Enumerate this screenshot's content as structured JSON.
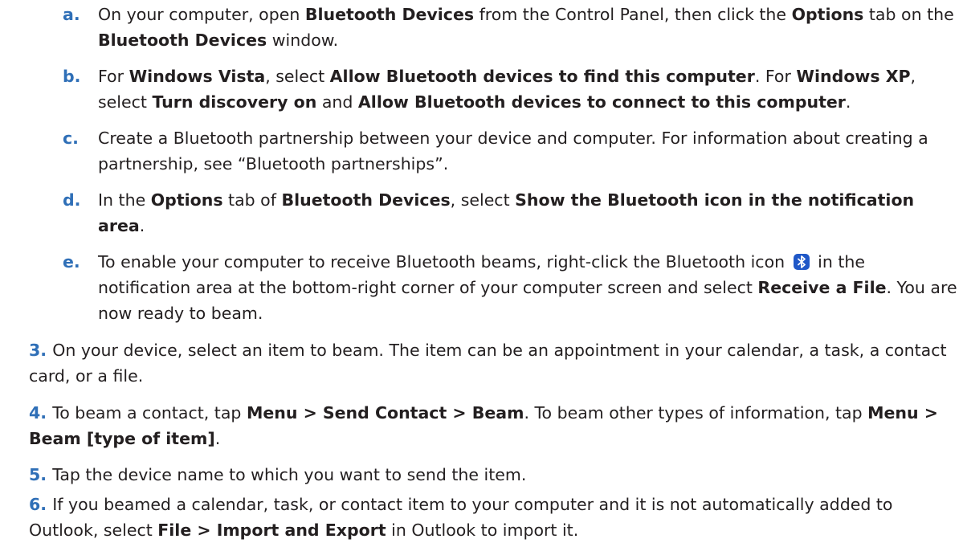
{
  "colors": {
    "marker": "#2f6fb7",
    "text": "#231f20",
    "bluetooth_icon": "#1f57c7"
  },
  "sub_steps": [
    {
      "marker": "a.",
      "segments": [
        {
          "t": "On your computer, open ",
          "b": false
        },
        {
          "t": "Bluetooth Devices",
          "b": true
        },
        {
          "t": " from the Control Panel, then click the ",
          "b": false
        },
        {
          "t": "Options",
          "b": true
        },
        {
          "t": " tab on the ",
          "b": false
        },
        {
          "t": "Bluetooth Devices",
          "b": true
        },
        {
          "t": " window.",
          "b": false
        }
      ]
    },
    {
      "marker": "b.",
      "segments": [
        {
          "t": "For ",
          "b": false
        },
        {
          "t": "Windows Vista",
          "b": true
        },
        {
          "t": ", select ",
          "b": false
        },
        {
          "t": "Allow Bluetooth devices to find this computer",
          "b": true
        },
        {
          "t": ". For ",
          "b": false
        },
        {
          "t": "Windows XP",
          "b": true
        },
        {
          "t": ", select ",
          "b": false
        },
        {
          "t": "Turn discovery on",
          "b": true
        },
        {
          "t": " and ",
          "b": false
        },
        {
          "t": "Allow Bluetooth devices to connect to this computer",
          "b": true
        },
        {
          "t": ".",
          "b": false
        }
      ]
    },
    {
      "marker": "c.",
      "segments": [
        {
          "t": "Create a Bluetooth partnership between your device and computer. For information about creating a partnership, see “Bluetooth partnerships”.",
          "b": false
        }
      ]
    },
    {
      "marker": "d.",
      "segments": [
        {
          "t": "In the ",
          "b": false
        },
        {
          "t": "Options",
          "b": true
        },
        {
          "t": " tab of ",
          "b": false
        },
        {
          "t": "Bluetooth Devices",
          "b": true
        },
        {
          "t": ", select ",
          "b": false
        },
        {
          "t": "Show the Bluetooth icon in the notification area",
          "b": true
        },
        {
          "t": ".",
          "b": false
        }
      ]
    },
    {
      "marker": "e.",
      "icon": "bluetooth-icon",
      "segments": [
        {
          "t": "To enable your computer to receive Bluetooth beams, right-click the Bluetooth icon ",
          "b": false
        },
        {
          "icon": true
        },
        {
          "t": " in the notification area at the bottom-right corner of your computer screen and select ",
          "b": false
        },
        {
          "t": "Receive a File",
          "b": true
        },
        {
          "t": ". You are now ready to beam.",
          "b": false
        }
      ]
    }
  ],
  "main_steps": [
    {
      "marker": "3.",
      "segments": [
        {
          "t": "On your device, select an item to beam. The item can be an appointment in your calendar, a task, a contact card, or a file.",
          "b": false
        }
      ]
    },
    {
      "marker": "4.",
      "segments": [
        {
          "t": "To beam a contact, tap ",
          "b": false
        },
        {
          "t": "Menu > Send Contact > Beam",
          "b": true
        },
        {
          "t": ". To beam other types of information, tap ",
          "b": false
        },
        {
          "t": "Menu > Beam [type of item]",
          "b": true
        },
        {
          "t": ".",
          "b": false
        }
      ]
    },
    {
      "marker": "5.",
      "segments": [
        {
          "t": "Tap the device name to which you want to send the item.",
          "b": false
        }
      ]
    },
    {
      "marker": "6.",
      "segments": [
        {
          "t": "If you beamed a calendar, task, or contact item to your computer and it is not automatically added to Outlook, select ",
          "b": false
        },
        {
          "t": "File > Import and Export",
          "b": true
        },
        {
          "t": " in Outlook to import it.",
          "b": false
        }
      ]
    }
  ]
}
